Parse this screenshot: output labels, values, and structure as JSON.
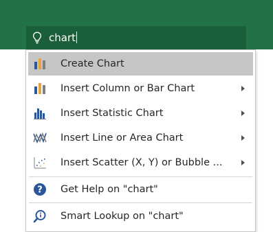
{
  "search": {
    "query": "chart",
    "icon": "lightbulb-icon"
  },
  "colors": {
    "ribbon": "#217346",
    "search_box": "#1b5e3a",
    "highlight": "#c6c6c6",
    "help_blue": "#2b579a"
  },
  "menu": {
    "items": [
      {
        "label": "Create Chart",
        "icon": "column-chart-icon",
        "highlighted": true,
        "has_submenu": false
      },
      {
        "label": "Insert Column or Bar Chart",
        "icon": "column-bar-chart-icon",
        "has_submenu": true
      },
      {
        "label": "Insert Statistic Chart",
        "icon": "statistic-chart-icon",
        "has_submenu": true
      },
      {
        "label": "Insert Line or Area Chart",
        "icon": "line-area-chart-icon",
        "has_submenu": true
      },
      {
        "label": "Insert Scatter (X, Y) or Bubble ...",
        "icon": "scatter-chart-icon",
        "has_submenu": true
      },
      {
        "label": "Get Help on \"chart\"",
        "icon": "help-icon",
        "has_submenu": false
      },
      {
        "label": "Smart Lookup on \"chart\"",
        "icon": "smart-lookup-icon",
        "has_submenu": false
      }
    ]
  }
}
